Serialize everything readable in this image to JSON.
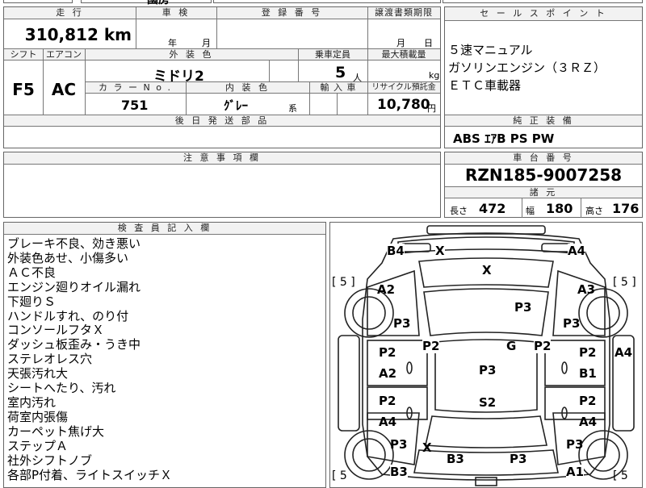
{
  "top_cut": {
    "left_text": "",
    "mid_text": "國房"
  },
  "form": {
    "h_travel": "走 行",
    "mileage": "310,812 km",
    "h_inspection": "車 検",
    "inspection_year": "年",
    "inspection_month": "月",
    "h_registration": "登 録 番 号",
    "registration_value": "",
    "h_transfer_deadline": "譲渡書類期限",
    "transfer_month": "月",
    "transfer_day": "日",
    "h_shift": "シフト",
    "h_aircon": "エアコン",
    "h_exterior": "外 装 色",
    "h_capacity": "乗車定員",
    "h_max_load": "最大積載量",
    "shift": "F5",
    "aircon": "AC",
    "exterior_color": "ミドリ2",
    "capacity": "5",
    "capacity_unit": "人",
    "max_load_unit": "kg",
    "h_color_no": "カ ラ ー N o .",
    "h_interior": "内 装 色",
    "h_import": "輸 入 車",
    "h_recycle": "リサイクル預託金",
    "color_no": "751",
    "interior_color": "ｸﾞﾚｰ",
    "interior_suffix": "系",
    "recycle_fee": "10,780",
    "recycle_unit": "円",
    "h_later_parts": "後 日 発 送 部 品",
    "h_notes": "注 意 事 項 欄"
  },
  "sales_points": {
    "header": "セ ー ル ス ポ イ ン ト",
    "lines": [
      "５速マニュアル",
      "ガソリンエンジン（３ＲＺ）",
      "ＥＴＣ車載器"
    ]
  },
  "equipment": {
    "header": "純 正 装 備",
    "value": "ABS ｴｱB PS PW"
  },
  "chassis": {
    "header": "車 台 番 号",
    "number": "RZN185-9007258",
    "specs_header": "諸 元",
    "length_label": "長さ",
    "length": "472",
    "width_label": "幅",
    "width": "180",
    "height_label": "高さ",
    "height": "176"
  },
  "inspector": {
    "header": "検 査 員 記 入 欄",
    "lines": [
      "ブレーキ不良、効き悪い",
      "外装色あせ、小傷多い",
      "ＡＣ不良",
      "エンジン廻りオイル漏れ",
      "下廻りＳ",
      "ハンドルすれ、のり付",
      "コンソールフタＸ",
      "ダッシュ板歪み・うき中",
      "ステレオレス穴",
      "天張汚れ大",
      "シートへたり、汚れ",
      "室内汚れ",
      "荷室内張傷",
      "カーペット焦げ大",
      "ステップＡ",
      "社外シフトノブ",
      "各部P付着、ライトスイッチＸ"
    ]
  },
  "diagram": {
    "tire_fl": "[ 5 ]",
    "tire_fr": "[ 5 ]",
    "tire_rl": "[ 5",
    "tire_rr": "[ 5",
    "marks": {
      "b4": "B4",
      "x_top": "X",
      "a4_top": "A4",
      "x_hood": "X",
      "a2_left": "A2",
      "a3_right": "A3",
      "p3_roof": "P3",
      "p3_lf": "P3",
      "p3_rf": "P3",
      "p2_lw": "P2",
      "p2_rw": "P2",
      "g_center": "G",
      "p2_ld1": "P2",
      "a2_ld1": "A2",
      "p2_rd1": "P2",
      "b1_rd1": "B1",
      "a4_side": "A4",
      "p3_mid": "P3",
      "p2_ld2": "P2",
      "a4_ld2": "A4",
      "p2_rd2": "P2",
      "a4_rd2": "A4",
      "s2_mid": "S2",
      "p3_lr": "P3",
      "x_lr": "X",
      "b3_bottom": "B3",
      "p3_bottom": "P3",
      "p3_rr": "P3",
      "b3_corner": "B3",
      "a1_corner": "A1"
    }
  }
}
